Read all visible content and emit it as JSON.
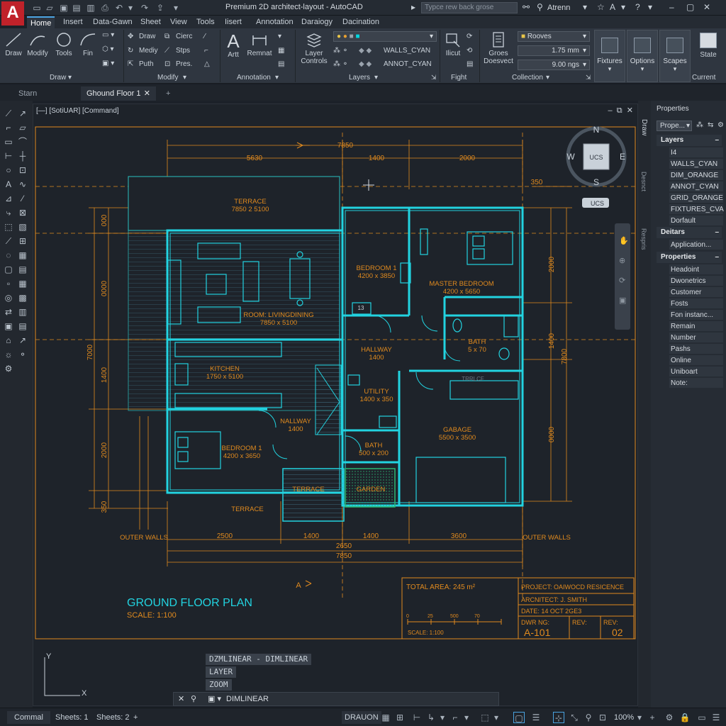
{
  "app": {
    "logo": "A",
    "title": "Premium 2D architect-layout - AutoCAD",
    "search_placeholder": "Typce rew back grose",
    "user": "Atrenn"
  },
  "tabs": [
    "Home",
    "Insert",
    "Data-Gawn",
    "Sheet",
    "View",
    "Tools",
    "Iisert",
    "Annotation",
    "Daraiogy",
    "Dacination"
  ],
  "ribbon": {
    "draw_group": {
      "label": "Draw",
      "buttons": [
        "Draw",
        "Modify",
        "Tools",
        "Fin"
      ]
    },
    "modify_group": {
      "label": "Modify",
      "items": [
        "Draw",
        "Cierc",
        "Mediy",
        "Stps",
        "Puth",
        "Pres."
      ]
    },
    "annotation_group": {
      "label": "Annotation",
      "buttons": [
        "Artt",
        "Remnat"
      ]
    },
    "layers_group": {
      "label": "Layers",
      "big": "Layer Controls",
      "layer1": "WALLS_CYAN",
      "layer2": "ANNOT_CYAN"
    },
    "fight_group": {
      "label": "Fight",
      "big": "Ilicut"
    },
    "collection_group": {
      "label": "Collection",
      "big": "Groes Doesvect",
      "style": "Rooves",
      "value1": "1.75 mm",
      "value2": "9.00 ngs"
    },
    "right_buttons": [
      "Fixtures",
      "Options",
      "Scapes",
      "State",
      "Current"
    ]
  },
  "doc_tabs": [
    "Starn",
    "Ghound Floor 1"
  ],
  "viewport": {
    "header": "[—] [SotiUAR] [Command]",
    "ucs_label": "UCS",
    "compass": {
      "n": "N",
      "s": "S",
      "e": "E",
      "w": "W"
    },
    "ucs_badge": "UCS"
  },
  "drawing": {
    "dims_top": {
      "overall": "7850",
      "d1": "5630",
      "d2": "1400",
      "d3": "2000",
      "side": "350"
    },
    "dims_bottom": {
      "d1": "2500",
      "d2": "1400",
      "d3": "1400",
      "d4": "3600",
      "overall1": "2650",
      "overall2": "7850"
    },
    "dims_left": {
      "d1": "000",
      "d2": "0000",
      "d3": "1400",
      "d4": "2000",
      "d5": "350",
      "overall": "7000"
    },
    "dims_right": {
      "d1": "2000",
      "d2": "1400",
      "d3": "0000",
      "overall": "7800"
    },
    "rooms": [
      {
        "name": "TERRACE",
        "size": "7850 2 5100"
      },
      {
        "name": "ROOM: LIVINGDINING",
        "size": "7850 x 5100"
      },
      {
        "name": "BEDROOM 1",
        "size": "4200 x 3850"
      },
      {
        "name": "MASTER BEDROOM",
        "size": "4200 x 5650"
      },
      {
        "name": "HALLWAY",
        "size": "1400"
      },
      {
        "name": "BATH",
        "size": "5 x 70"
      },
      {
        "name": "KITCHEN",
        "size": "1750 x 5100"
      },
      {
        "name": "UTILITY",
        "size": "1400 x 350"
      },
      {
        "name": "NALLWAY",
        "size": "1400"
      },
      {
        "name": "GABAGE",
        "size": "5500 x 3500"
      },
      {
        "name": "BEDROOM 1",
        "size": "4200 x 3650"
      },
      {
        "name": "BATH",
        "size": "500 x 200"
      },
      {
        "name": "TERRACE",
        "size": ""
      },
      {
        "name": "GARDEN",
        "size": ""
      },
      {
        "name": "TERRACE",
        "size": ""
      }
    ],
    "room_tag": "13",
    "stair_tag": "TRRLCF",
    "outer_walls_left": "OUTER WALLS",
    "outer_walls_right": "OUTER WALLS",
    "section_mark": "A",
    "plan_title": "GROUND FLOOR PLAN",
    "plan_scale": "SCALE: 1:100"
  },
  "title_block": {
    "area": "TOTAL AREA: 245 m²",
    "project": "PROJECT: OAIWOCD RESICENCE",
    "architect": "ARCNITECT: J. SMITH",
    "date": "DATE: 14 OCT 2GE3",
    "dwg_label": "DWR NG:",
    "dwg_no": "A-101",
    "rev_label1": "REV:",
    "rev_label2": "REV:",
    "rev": "02",
    "scale": "SCALE: 1:100",
    "scalebar": [
      "0",
      "25",
      "500",
      "70"
    ]
  },
  "right_panel": {
    "title": "Properties",
    "dropdown": "Prope...",
    "strip_labels": [
      "Draw",
      "Desnct",
      "Respris"
    ],
    "layers_title": "Layers",
    "layers": [
      "I4",
      "WALLS_CYAN",
      "DIM_ORANGE",
      "ANNOT_CYAN",
      "GRID_ORANGE",
      "FIXTURES_CVA",
      "Dorfault"
    ],
    "details_title": "Deitars",
    "details": [
      "Application..."
    ],
    "properties_title": "Properties",
    "properties": [
      "Headoint",
      "Dwonetrics",
      "Customer",
      "Fosts",
      "Fon instanc...",
      "Remain",
      "Number",
      "Pashs",
      "Online",
      "Uniboart",
      "Note:"
    ]
  },
  "command": {
    "history": [
      "DZMLINEAR - DIMLINEAR",
      "LAYER",
      "ZOOM"
    ],
    "current": "DIMLINEAR",
    "axis_y": "Y",
    "axis_x": "X"
  },
  "status": {
    "layout_tabs": [
      "Commal",
      "Sheets: 1",
      "Sheets: 2"
    ],
    "mode": "DRAUON",
    "zoom": "100%"
  },
  "colors": {
    "accent": "#00d8e0",
    "dim": "#e08a1e",
    "bg": "#1c2129"
  }
}
